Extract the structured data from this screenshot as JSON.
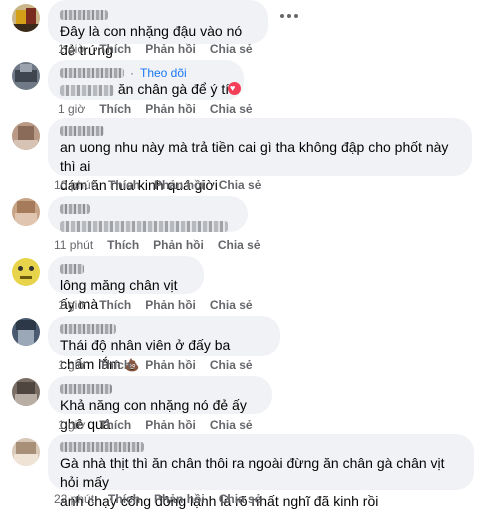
{
  "comments": [
    {
      "text": "Đây là con nhặng đậu vào nó đẻ trứng",
      "time": "1 giờ",
      "like": "Thích",
      "reply": "Phản hồi",
      "share": "Chia sẻ"
    },
    {
      "follow": "Theo dõi",
      "dot": "·",
      "text": "ăn chân gà để ý tí",
      "time": "1 giờ",
      "like": "Thích",
      "reply": "Phản hồi",
      "share": "Chia sẻ",
      "reaction_icon": "heart-icon"
    },
    {
      "text_line1": "an uong nhu này mà trả tiền cai gì tha không đập cho phốt này thì ai",
      "text_line2": "dám ăn nua kinh quá giời",
      "time": "10 phút",
      "like": "Thích",
      "reply": "Phản hồi",
      "share": "Chia sẻ"
    },
    {
      "time": "11 phút",
      "like": "Thích",
      "reply": "Phản hồi",
      "share": "Chia sẻ"
    },
    {
      "text": "lông măng chân vịt ấy mà",
      "time": "1 giờ",
      "like": "Thích",
      "reply": "Phản hồi",
      "share": "Chia sẻ"
    },
    {
      "text": "Thái độ nhân viên ở đấy ba chấm lắm",
      "time": "1 giờ",
      "like": "Thích",
      "reply": "Phản hồi",
      "share": "Chia sẻ",
      "emoji": "poop-icon"
    },
    {
      "text": "Khả năng con nhặng nó đẻ ấy ghê quá",
      "time": "1 giờ",
      "like": "Thích",
      "reply": "Phản hồi",
      "share": "Chia sẻ"
    },
    {
      "text_line1": "Gà nhà thịt thì ăn chân thôi ra ngoài đừng ăn chân gà chân vịt hỏi mấy",
      "text_line2": "anh chạy công đông lạnh là rõ nhất nghĩ đã kinh rồi",
      "time": "22 phút",
      "like": "Thích",
      "reply": "Phản hồi",
      "share": "Chia sẻ"
    }
  ],
  "colors": {
    "bubble": "#f0f2f5",
    "meta": "#65676b",
    "link": "#1877f2",
    "heart": "#f33e58"
  }
}
